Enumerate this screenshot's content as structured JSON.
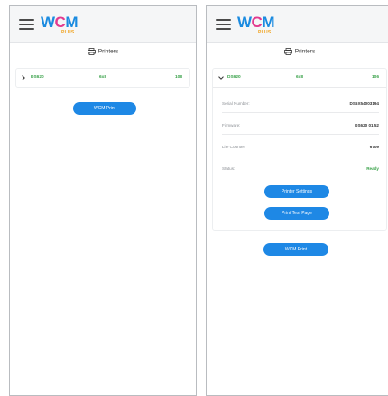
{
  "logo": {
    "w": "W",
    "c": "C",
    "m": "M",
    "plus": "PLUS"
  },
  "section_title": "Printers",
  "left": {
    "printer": {
      "model": "DS620",
      "size": "6x8",
      "count": "108"
    },
    "print_button": "WCM Print"
  },
  "right": {
    "printer": {
      "model": "DS620",
      "size": "6x8",
      "count": "106"
    },
    "details": [
      {
        "label": "Serial Number:",
        "value": "DS6X54003194"
      },
      {
        "label": "Firmware:",
        "value": "DS620 01.52"
      },
      {
        "label": "Life Counter:",
        "value": "6709"
      },
      {
        "label": "Status:",
        "value": "Ready"
      }
    ],
    "settings_button": "Printer Settings",
    "test_button": "Print Test Page",
    "print_button": "WCM Print"
  },
  "colors": {
    "accent": "#1e88e5",
    "status_green": "#3aa24a",
    "logo_blue": "#1b8be0",
    "logo_pink": "#e23a8f",
    "logo_orange": "#f0a21c"
  },
  "icons": [
    "hamburger-menu-icon",
    "printer-icon",
    "chevron-right-icon",
    "chevron-down-icon"
  ]
}
